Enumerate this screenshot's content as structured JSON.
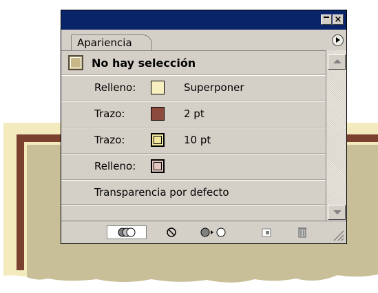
{
  "panel": {
    "title_buttons": {
      "minimize": "minimize-icon",
      "close": "×"
    },
    "tab_label": "Apariencia",
    "menu_icon": "panel-menu-arrow-icon",
    "header": {
      "text": "No hay selección",
      "swatch_color": "#c8b887"
    },
    "rows": [
      {
        "label": "Relleno:",
        "swatch_color": "#f7efc0",
        "value": "Superponer",
        "swatch_style": "fill"
      },
      {
        "label": "Trazo:",
        "swatch_color": "#8b4a3c",
        "value": "2 pt",
        "swatch_style": "fill"
      },
      {
        "label": "Trazo:",
        "swatch_color": "#f2e6a0",
        "value": "10 pt",
        "swatch_style": "stroke"
      },
      {
        "label": "Relleno:",
        "swatch_color": "#e3c7c0",
        "value": "",
        "swatch_style": "stroke"
      },
      {
        "label": "Transparencia por defecto"
      }
    ],
    "bottom_icons": [
      "new-art-basic-appearance-icon",
      "clear-appearance-icon",
      "reduce-to-basic-appearance-icon",
      "duplicate-item-icon",
      "delete-item-icon",
      "resize-grip-icon"
    ]
  },
  "colors": {
    "titlebar": "#0a246a",
    "panel_bg": "#d4d0c8",
    "artwork_outer": "#f3ebbd",
    "artwork_stroke": "#7a4030",
    "artwork_inner": "#c8bf98"
  }
}
